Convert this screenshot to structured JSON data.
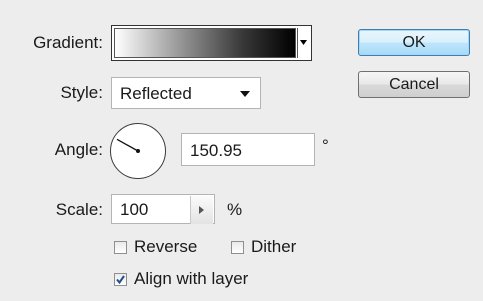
{
  "gradient": {
    "label": "Gradient:"
  },
  "style": {
    "label": "Style:",
    "value": "Reflected"
  },
  "angle": {
    "label": "Angle:",
    "value": "150.95",
    "unit": "°",
    "dial_degrees": 150.95
  },
  "scale": {
    "label": "Scale:",
    "value": "100",
    "unit": "%"
  },
  "options": {
    "reverse": {
      "label": "Reverse",
      "checked": false
    },
    "dither": {
      "label": "Dither",
      "checked": false
    },
    "align": {
      "label": "Align with layer",
      "checked": true
    }
  },
  "buttons": {
    "ok": "OK",
    "cancel": "Cancel"
  },
  "colors": {
    "accent_border": "#3c7fb1",
    "check_mark": "#1f4e8c"
  }
}
